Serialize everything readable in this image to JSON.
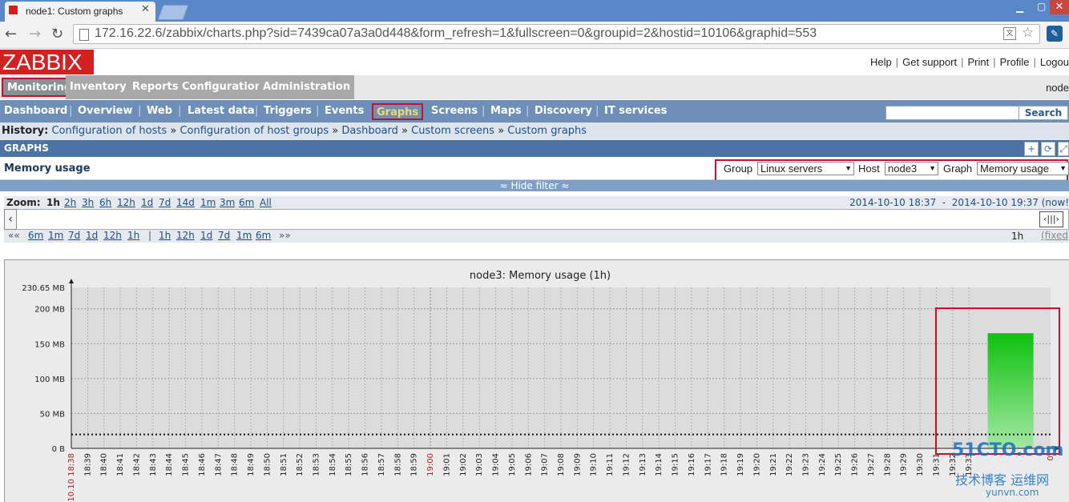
{
  "browser": {
    "tab_title": "node1: Custom graphs",
    "url": "172.16.22.6/zabbix/charts.php?sid=7439ca07a3a0d448&form_refresh=1&fullscreen=0&groupid=2&hostid=10106&graphid=553"
  },
  "header": {
    "logo": "ZABBIX",
    "links": [
      "Help",
      "Get support",
      "Print",
      "Profile",
      "Logou"
    ],
    "host_name": "node"
  },
  "main_menu": [
    "Monitoring",
    "Inventory",
    "Reports",
    "Configuration",
    "Administration"
  ],
  "sub_menu": [
    "Dashboard",
    "Overview",
    "Web",
    "Latest data",
    "Triggers",
    "Events",
    "Graphs",
    "Screens",
    "Maps",
    "Discovery",
    "IT services"
  ],
  "search": {
    "button": "Search"
  },
  "history": {
    "label": "History:",
    "items": [
      "Configuration of hosts",
      "Configuration of host groups",
      "Dashboard",
      "Custom screens",
      "Custom graphs"
    ]
  },
  "section": {
    "title": "GRAPHS"
  },
  "page": {
    "title": "Memory usage"
  },
  "filter": {
    "group_label": "Group",
    "group_value": "Linux servers",
    "host_label": "Host",
    "host_value": "node3",
    "graph_label": "Graph",
    "graph_value": "Memory usage",
    "hide_filter": "Hide filter"
  },
  "zoom": {
    "label": "Zoom:",
    "levels": [
      "1h",
      "2h",
      "3h",
      "6h",
      "12h",
      "1d",
      "7d",
      "14d",
      "1m",
      "3m",
      "6m",
      "All"
    ],
    "period_from": "2014-10-10 18:37",
    "period_to": "2014-10-10 19:37 (now!"
  },
  "nav": {
    "back_links": [
      "6m",
      "1m",
      "7d",
      "1d",
      "12h",
      "1h"
    ],
    "fwd_links": [
      "1h",
      "12h",
      "1d",
      "7d",
      "1m",
      "6m"
    ],
    "start": "««",
    "end": "»»",
    "period": "1h",
    "fixed": "(fixed"
  },
  "watermark": {
    "line1": "51CTO.com",
    "line2": "技术博客",
    "line3": "运维网",
    "line4": "yunvn.com"
  },
  "chart_data": {
    "type": "area",
    "title": "node3: Memory usage (1h)",
    "y_max_label": "230.65 MB",
    "ylim": [
      0,
      230.65
    ],
    "y_ticks": [
      {
        "value": 0,
        "label": "0 B"
      },
      {
        "value": 50,
        "label": "50 MB"
      },
      {
        "value": 100,
        "label": "100 MB"
      },
      {
        "value": 150,
        "label": "150 MB"
      },
      {
        "value": 200,
        "label": "200 MB"
      }
    ],
    "x_labels": [
      "18:39",
      "18:40",
      "18:41",
      "18:42",
      "18:43",
      "18:44",
      "18:45",
      "18:46",
      "18:47",
      "18:48",
      "18:49",
      "18:50",
      "18:51",
      "18:52",
      "18:53",
      "18:54",
      "18:55",
      "18:56",
      "18:57",
      "18:58",
      "18:59",
      "19:00",
      "19:01",
      "19:02",
      "19:03",
      "19:04",
      "19:05",
      "19:06",
      "19:07",
      "19:08",
      "19:09",
      "19:10",
      "19:11",
      "19:12",
      "19:13",
      "19:14",
      "19:15",
      "19:16",
      "19:17",
      "19:18",
      "19:19",
      "19:20",
      "19:21",
      "19:22",
      "19:23",
      "19:24",
      "19:25",
      "19:26",
      "19:27",
      "19:28",
      "19:29",
      "19:30",
      "19:31",
      "19:32",
      "19:33"
    ],
    "x_start_label": "10.10 18:38",
    "x_end_label": "0.",
    "highlight_label": "19:00",
    "series": [
      {
        "name": "",
        "x_start": "19:34",
        "x_end": "19:37",
        "value": 165,
        "color": "#1ec81e"
      }
    ],
    "threshold": {
      "value": 20,
      "style": "dotted",
      "color": "#111111"
    },
    "grid": true
  }
}
